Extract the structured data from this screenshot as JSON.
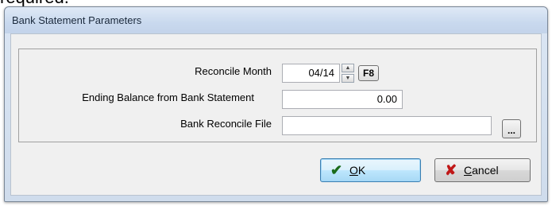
{
  "background_text": "required.",
  "dialog": {
    "title": "Bank Statement Parameters",
    "reconcile_month": {
      "label": "Reconcile Month",
      "value": "04/14",
      "f8_label": "F8"
    },
    "ending_balance": {
      "label": "Ending Balance from Bank Statement",
      "value": "0.00"
    },
    "reconcile_file": {
      "label": "Bank Reconcile File",
      "value": "",
      "browse_label": "..."
    },
    "ok_button": {
      "accel": "O",
      "rest": "K",
      "icon": "check-icon"
    },
    "cancel_button": {
      "accel": "C",
      "rest": "ancel",
      "icon": "x-icon"
    },
    "colors": {
      "ok_icon": "#1a6b1a",
      "cancel_icon": "#c01818"
    }
  }
}
